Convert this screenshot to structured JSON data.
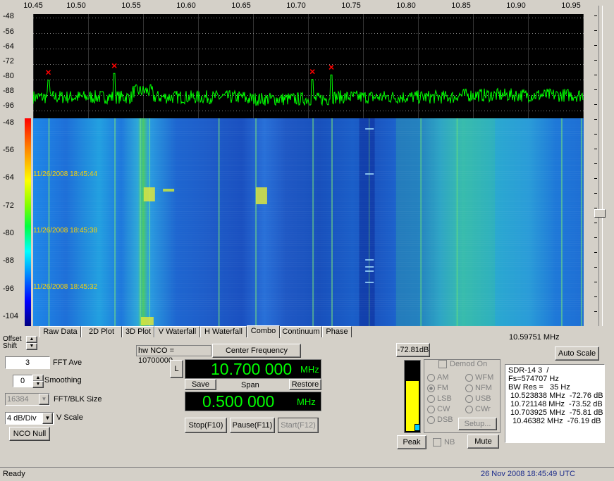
{
  "spectrum": {
    "x_ticks": [
      "10.45",
      "10.50",
      "10.55",
      "10.60",
      "10.65",
      "10.70",
      "10.75",
      "10.80",
      "10.85",
      "10.90",
      "10.95"
    ],
    "y_ticks": [
      "-48",
      "-56",
      "-64",
      "-72",
      "-80",
      "-88",
      "-96"
    ],
    "peaks_mhz": [
      10.46382,
      10.523838,
      10.703925,
      10.721148
    ],
    "peaks_db": [
      -76.19,
      -72.76,
      -75.81,
      -73.52
    ],
    "trace_color": "#00ff00",
    "marker_color": "#ff0000"
  },
  "waterfall": {
    "y_ticks": [
      "-48",
      "-56",
      "-64",
      "-72",
      "-80",
      "-88",
      "-96",
      "-104"
    ],
    "timestamps": [
      "11/26/2008 18:45:44",
      "11/26/2008 18:45:38",
      "11/26/2008 18:45:32"
    ]
  },
  "tabs": [
    "Raw Data",
    "2D Plot",
    "3D Plot",
    "V Waterfall",
    "H Waterfall",
    "Combo",
    "Continuum",
    "Phase"
  ],
  "active_tab": "Combo",
  "cursor_freq": "10.59751 MHz",
  "offset_label": "Offset",
  "shift_label": "Shift",
  "fft_ave": {
    "value": "3",
    "label": "FFT Ave"
  },
  "smoothing": {
    "value": "0",
    "label": "Smoothing"
  },
  "fft_blk": {
    "value": "16384",
    "label": "FFT/BLK Size"
  },
  "vscale": {
    "value": "4 dB/Div",
    "label": "V Scale"
  },
  "nco_null": "NCO Null",
  "hw_nco": "hw NCO = 10700000",
  "center_freq_btn": "Center Frequency",
  "l_btn": "L",
  "center_value": "10.700 000",
  "center_unit": "MHz",
  "save_btn": "Save",
  "span_label": "Span",
  "restore_btn": "Restore",
  "span_value": "0.500 000",
  "span_unit": "MHz",
  "stop_btn": "Stop(F10)",
  "pause_btn": "Pause(F11)",
  "start_btn": "Start(F12)",
  "level_db": "-72.81dB",
  "level_fraction": 0.72,
  "demod_on": "Demod On",
  "modes_left": [
    "AM",
    "FM",
    "LSB",
    "CW",
    "DSB"
  ],
  "modes_right": [
    "WFM",
    "NFM",
    "USB",
    "CWr"
  ],
  "setup_btn": "Setup...",
  "peak_btn": "Peak",
  "nb_label": "NB",
  "mute_btn": "Mute",
  "auto_scale_btn": "Auto Scale",
  "info_lines": [
    "SDR-14 3  /",
    "Fs=574707 Hz",
    "BW Res =   35 Hz",
    " 10.523838 MHz  -72.76 dB",
    " 10.721148 MHz  -73.52 dB",
    " 10.703925 MHz  -75.81 dB",
    "  10.46382 MHz  -76.19 dB"
  ],
  "status_left": "Ready",
  "status_right": "26 Nov 2008  18:45:49 UTC"
}
